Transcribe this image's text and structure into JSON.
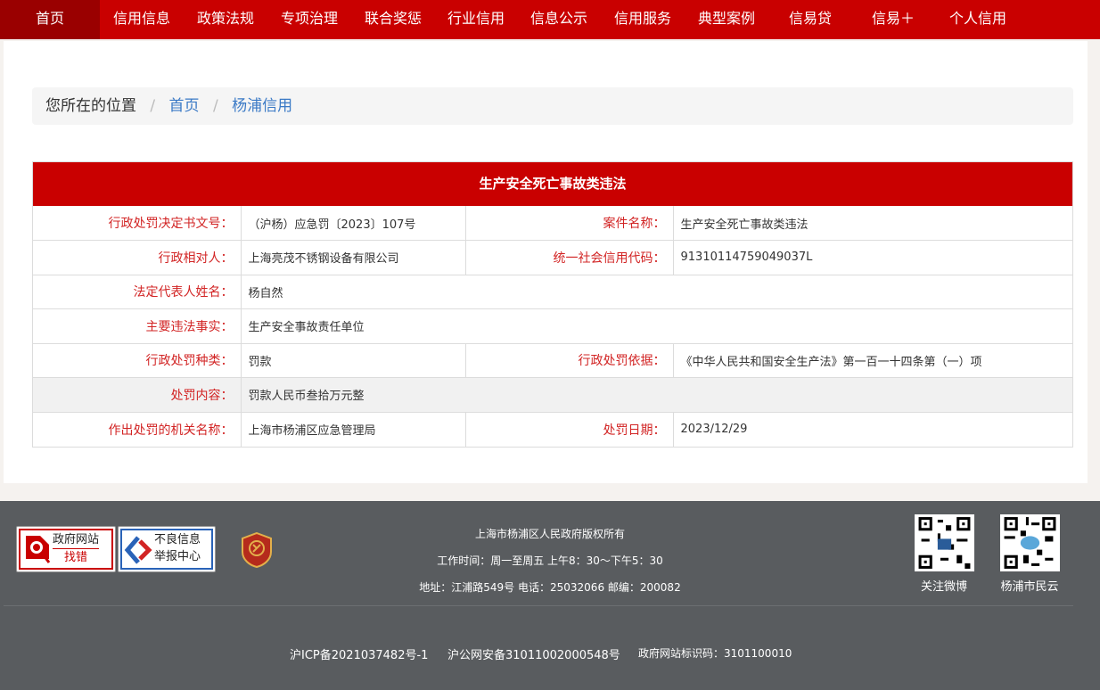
{
  "nav": {
    "items": [
      "首页",
      "信用信息",
      "政策法规",
      "专项治理",
      "联合奖惩",
      "行业信用",
      "信息公示",
      "信用服务",
      "典型案例",
      "信易贷",
      "信易＋",
      "个人信用"
    ]
  },
  "breadcrumb": {
    "prefix": "您所在的位置",
    "sep": "/",
    "home": "首页",
    "current": "杨浦信用"
  },
  "detail": {
    "title": "生产安全死亡事故类违法",
    "labels": {
      "doc_no": "行政处罚决定书文号：",
      "case_name": "案件名称：",
      "party": "行政相对人：",
      "credit_code": "统一社会信用代码：",
      "legal_rep": "法定代表人姓名：",
      "facts": "主要违法事实：",
      "penalty_type": "行政处罚种类：",
      "basis": "行政处罚依据：",
      "content": "处罚内容：",
      "authority": "作出处罚的机关名称：",
      "date": "处罚日期："
    },
    "values": {
      "doc_no": "（沪杨）应急罚〔2023〕107号",
      "case_name": "生产安全死亡事故类违法",
      "party": "上海亮茂不锈钢设备有限公司",
      "credit_code": "91310114759049037L",
      "legal_rep": "杨自然",
      "facts": "生产安全事故责任单位",
      "penalty_type": "罚款",
      "basis": "《中华人民共和国安全生产法》第一百一十四条第（一）项",
      "content": "罚款人民币叁拾万元整",
      "authority": "上海市杨浦区应急管理局",
      "date": "2023/12/29"
    }
  },
  "footer": {
    "badge1": {
      "line1": "政府网站",
      "line2": "找错"
    },
    "badge2": {
      "line1": "不良信息",
      "line2": "举报中心"
    },
    "copyright": "上海市杨浦区人民政府版权所有",
    "hours": "工作时间：周一至周五 上午8：30～下午5：30",
    "address": "地址：江浦路549号 电话：25032066 邮编：200082",
    "qr1_label": "关注微博",
    "qr2_label": "杨浦市民云",
    "icp": "沪ICP备2021037482号-1",
    "police": "沪公网安备31011002000548号",
    "site_id": "政府网站标识码：3101100010"
  },
  "colors": {
    "brand_red": "#c90000",
    "label_red": "#d22424",
    "link_blue": "#3b7ac6",
    "footer_bg": "#595c5f"
  }
}
